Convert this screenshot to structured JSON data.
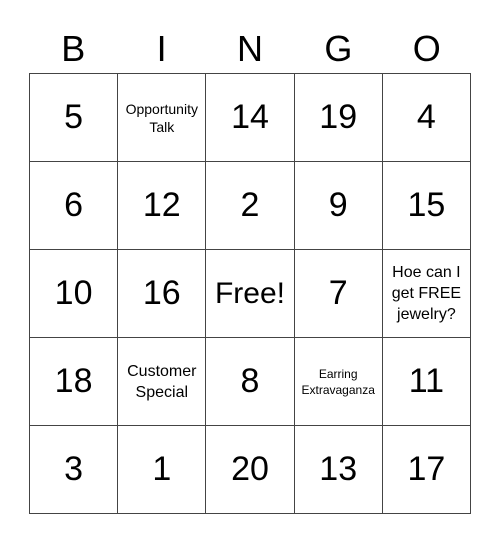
{
  "header": [
    "B",
    "I",
    "N",
    "G",
    "O"
  ],
  "rows": [
    [
      {
        "text": "5",
        "kind": "num"
      },
      {
        "text": "Opportunity Talk",
        "kind": "text-sm"
      },
      {
        "text": "14",
        "kind": "num"
      },
      {
        "text": "19",
        "kind": "num"
      },
      {
        "text": "4",
        "kind": "num"
      }
    ],
    [
      {
        "text": "6",
        "kind": "num"
      },
      {
        "text": "12",
        "kind": "num"
      },
      {
        "text": "2",
        "kind": "num"
      },
      {
        "text": "9",
        "kind": "num"
      },
      {
        "text": "15",
        "kind": "num"
      }
    ],
    [
      {
        "text": "10",
        "kind": "num"
      },
      {
        "text": "16",
        "kind": "num"
      },
      {
        "text": "Free!",
        "kind": "free"
      },
      {
        "text": "7",
        "kind": "num"
      },
      {
        "text": "Hoe can I get FREE jewelry?",
        "kind": "text-md"
      }
    ],
    [
      {
        "text": "18",
        "kind": "num"
      },
      {
        "text": "Customer Special",
        "kind": "text-md"
      },
      {
        "text": "8",
        "kind": "num"
      },
      {
        "text": "Earring Extravaganza",
        "kind": "text-xs"
      },
      {
        "text": "11",
        "kind": "num"
      }
    ],
    [
      {
        "text": "3",
        "kind": "num"
      },
      {
        "text": "1",
        "kind": "num"
      },
      {
        "text": "20",
        "kind": "num"
      },
      {
        "text": "13",
        "kind": "num"
      },
      {
        "text": "17",
        "kind": "num"
      }
    ]
  ]
}
